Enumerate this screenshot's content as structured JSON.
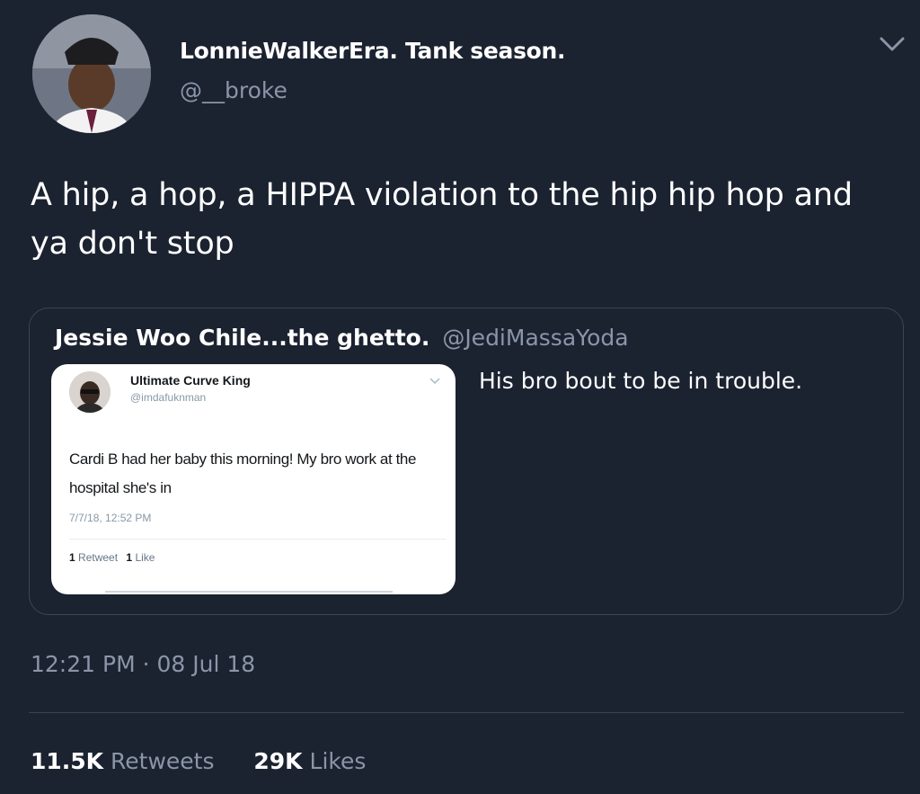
{
  "author": {
    "display_name": "LonnieWalkerEra. Tank season.",
    "handle": "@__broke",
    "avatar_icon": "profile-photo"
  },
  "tweet": {
    "text": "A hip, a hop, a HIPPA violation to the hip hip hop and ya don't stop",
    "timestamp": "12:21 PM · 08 Jul 18"
  },
  "quote": {
    "name": "Jessie Woo Chile...the ghetto.",
    "handle": "@JediMassaYoda",
    "text": "His bro bout to be in trouble.",
    "screenshot": {
      "name": "Ultimate Curve King",
      "handle": "@imdafuknman",
      "text": "Cardi B had her baby this morning! My bro work at the hospital she's in",
      "time": "7/7/18, 12:52 PM",
      "retweets_count": "1",
      "retweets_label": "Retweet",
      "likes_count": "1",
      "likes_label": "Like"
    }
  },
  "stats": {
    "retweets_count": "11.5K",
    "retweets_label": "Retweets",
    "likes_count": "29K",
    "likes_label": "Likes"
  },
  "colors": {
    "background": "#1b2230",
    "secondary_text": "#8a96a8",
    "border": "#3c4656"
  }
}
